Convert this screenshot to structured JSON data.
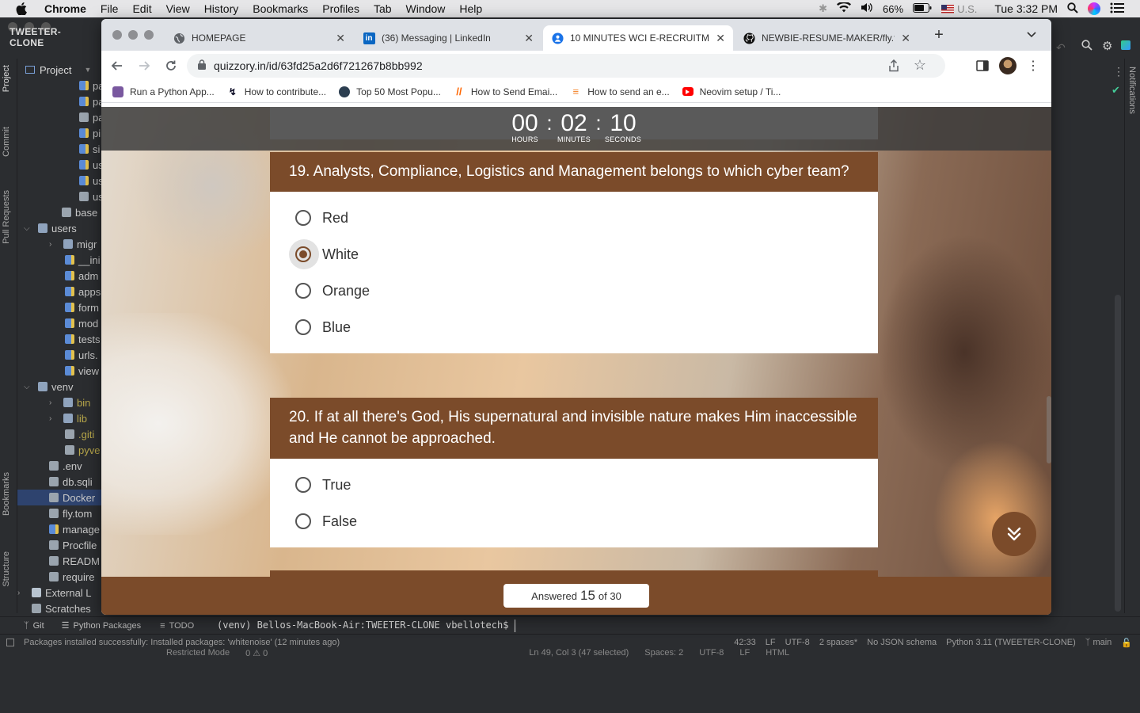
{
  "mac_menu": {
    "app": "Chrome",
    "items": [
      "File",
      "Edit",
      "View",
      "History",
      "Bookmarks",
      "Profiles",
      "Tab",
      "Window",
      "Help"
    ],
    "battery": "66%",
    "input_source": "U.S.",
    "clock": "Tue 3:32 PM"
  },
  "ide": {
    "project_name": "TWEETER-CLONE",
    "panel_title": "Project",
    "side_tabs": {
      "project": "Project",
      "commit": "Commit",
      "pull_requests": "Pull Requests",
      "bookmarks": "Bookmarks",
      "structure": "Structure",
      "notifications": "Notifications"
    },
    "tree": [
      {
        "label": "pa",
        "type": "py"
      },
      {
        "label": "pa",
        "type": "py"
      },
      {
        "label": "pa",
        "type": "file"
      },
      {
        "label": "pi",
        "type": "py"
      },
      {
        "label": "si",
        "type": "py"
      },
      {
        "label": "us",
        "type": "py"
      },
      {
        "label": "us",
        "type": "py"
      },
      {
        "label": "us",
        "type": "file"
      },
      {
        "label": "base",
        "type": "file"
      },
      {
        "label": "users",
        "type": "folder"
      },
      {
        "label": "migr",
        "type": "folder"
      },
      {
        "label": "__ini",
        "type": "py"
      },
      {
        "label": "adm",
        "type": "py"
      },
      {
        "label": "apps",
        "type": "py"
      },
      {
        "label": "form",
        "type": "py"
      },
      {
        "label": "mod",
        "type": "py"
      },
      {
        "label": "tests",
        "type": "py"
      },
      {
        "label": "urls.",
        "type": "py"
      },
      {
        "label": "view",
        "type": "py"
      },
      {
        "label": "venv",
        "type": "folder"
      },
      {
        "label": "bin",
        "type": "folder"
      },
      {
        "label": "lib",
        "type": "folder"
      },
      {
        "label": ".giti",
        "type": "file"
      },
      {
        "label": "pyve",
        "type": "file"
      },
      {
        "label": ".env",
        "type": "file"
      },
      {
        "label": "db.sqli",
        "type": "file"
      },
      {
        "label": "Docker",
        "type": "file"
      },
      {
        "label": "fly.tom",
        "type": "file"
      },
      {
        "label": "manage",
        "type": "py"
      },
      {
        "label": "Procfile",
        "type": "file"
      },
      {
        "label": "READM",
        "type": "file"
      },
      {
        "label": "require",
        "type": "file"
      },
      {
        "label": "External L",
        "type": "lib"
      },
      {
        "label": "Scratches",
        "type": "file"
      }
    ],
    "bottom_tabs": {
      "git": "Git",
      "python_packages": "Python Packages",
      "todo": "TODO"
    },
    "terminal": "(venv) Bellos-MacBook-Air:TWEETER-CLONE vbellotech$",
    "status_message": "Packages installed successfully: Installed packages: 'whitenoise' (12 minutes ago)",
    "status_right": {
      "position": "42:33",
      "line_ending": "LF",
      "encoding": "UTF-8",
      "indent": "2 spaces*",
      "schema": "No JSON schema",
      "interpreter": "Python 3.11 (TWEETER-CLONE)",
      "branch": "main"
    },
    "behind": {
      "restricted": "Restricted Mode",
      "problems": "0 ⚠ 0",
      "cursor": "Ln 49, Col 3 (47 selected)",
      "spaces": "Spaces: 2",
      "enc": "UTF-8",
      "eol": "LF",
      "lang": "HTML"
    }
  },
  "browser": {
    "tabs": [
      {
        "title": "HOMEPAGE",
        "icon": "globe-icon"
      },
      {
        "title": "(36) Messaging | LinkedIn",
        "icon": "linkedin-icon"
      },
      {
        "title": "10 MINUTES WCI E-RECRUITM",
        "icon": "quiz-icon",
        "active": true
      },
      {
        "title": "NEWBIE-RESUME-MAKER/fly.t",
        "icon": "github-icon"
      }
    ],
    "url": "quizzory.in/id/63fd25a2d6f721267b8bb992",
    "bookmarks": [
      {
        "label": "Run a Python App...",
        "icon": "heroku-icon"
      },
      {
        "label": "How to contribute...",
        "icon": "codecademy-icon"
      },
      {
        "label": "Top 50 Most Popu...",
        "icon": "bookmark-icon"
      },
      {
        "label": "How to Send Emai...",
        "icon": "slash-icon"
      },
      {
        "label": "How to send an e...",
        "icon": "stackoverflow-icon"
      },
      {
        "label": "Neovim setup / Ti...",
        "icon": "youtube-icon"
      }
    ]
  },
  "quiz": {
    "timer": {
      "hours": "00",
      "minutes": "02",
      "seconds": "10",
      "hours_label": "HOURS",
      "minutes_label": "MINUTES",
      "seconds_label": "SECONDS"
    },
    "questions": [
      {
        "text": "19. Analysts, Compliance, Logistics and Management belongs to which cyber team?",
        "options": [
          "Red",
          "White",
          "Orange",
          "Blue"
        ],
        "selected": "White"
      },
      {
        "text": "20. If at all there's God, His supernatural and invisible nature makes Him inaccessible and He cannot be approached.",
        "options": [
          "True",
          "False"
        ],
        "selected": null
      }
    ],
    "progress": {
      "prefix": "Answered",
      "answered": "15",
      "suffix": "of 30"
    },
    "colors": {
      "primary": "#7b4b2a",
      "timer_bg": "#5a5a5a"
    }
  }
}
